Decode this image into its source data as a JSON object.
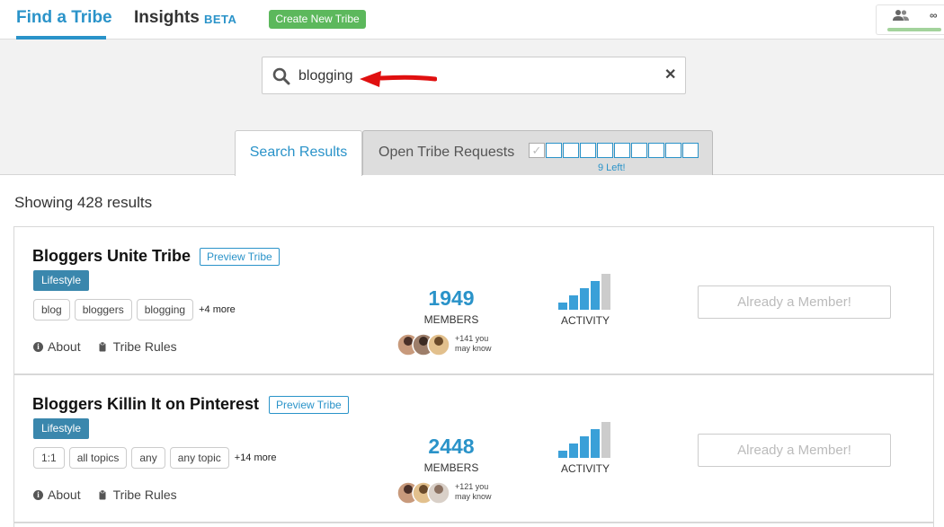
{
  "nav": {
    "find_tribe": "Find a Tribe",
    "insights": "Insights",
    "beta": "BETA",
    "create_button": "Create New Tribe",
    "account_icon": "group-icon",
    "account_count": "∞"
  },
  "search": {
    "value": "blogging",
    "search_icon": "search-icon",
    "clear_icon": "close-icon",
    "clear_glyph": "✕"
  },
  "tabs": {
    "search_results": "Search Results",
    "open_requests": "Open Tribe Requests",
    "requests_left": "9 Left!",
    "requests_used": 1,
    "requests_total": 10
  },
  "results": {
    "showing": "Showing 428 results",
    "items": [
      {
        "name": "Bloggers Unite Tribe",
        "preview_label": "Preview Tribe",
        "category": "Lifestyle",
        "tags": [
          "blog",
          "bloggers",
          "blogging"
        ],
        "more": "+4 more",
        "about": "About",
        "rules": "Tribe Rules",
        "members": "1949",
        "members_label": "MEMBERS",
        "know_line1": "+141 you",
        "know_line2": "may know",
        "activity_label": "ACTIVITY",
        "activity_level": 4,
        "activity_max": 5,
        "member_button": "Already a Member!"
      },
      {
        "name": "Bloggers Killin It on Pinterest",
        "preview_label": "Preview Tribe",
        "category": "Lifestyle",
        "tags": [
          "1:1",
          "all topics",
          "any",
          "any topic"
        ],
        "more": "+14 more",
        "about": "About",
        "rules": "Tribe Rules",
        "members": "2448",
        "members_label": "MEMBERS",
        "know_line1": "+121 you",
        "know_line2": "may know",
        "activity_label": "ACTIVITY",
        "activity_level": 4,
        "activity_max": 5,
        "member_button": "Already a Member!"
      }
    ]
  },
  "colors": {
    "accent": "#2a93c9",
    "create_green": "#5cb85c",
    "category_blue": "#3a87ad",
    "activity_on": "#3aa0d8",
    "activity_off": "#cccccc",
    "annotation_red": "#e01010"
  }
}
